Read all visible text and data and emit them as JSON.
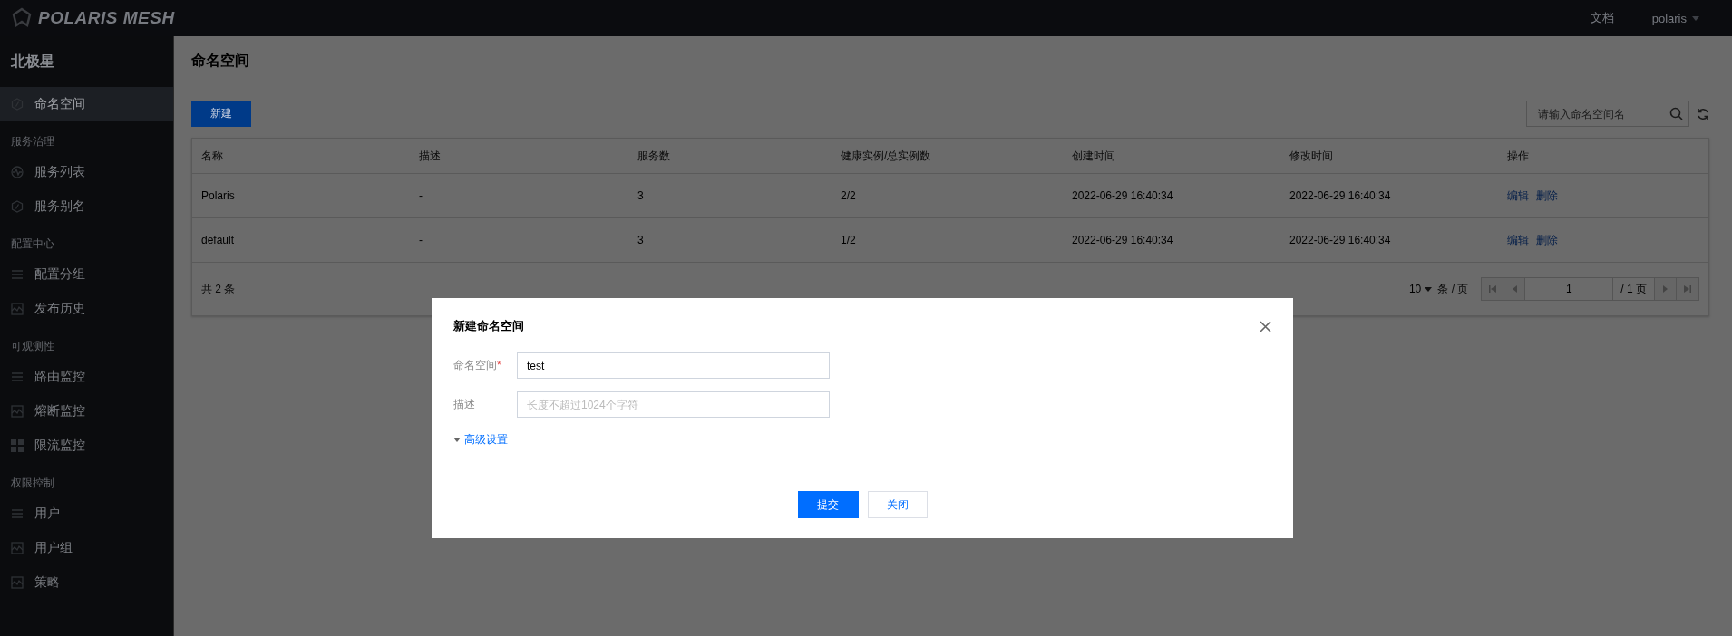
{
  "topbar": {
    "logo": "POLARIS MESH",
    "links": [
      "文档"
    ],
    "user": "polaris"
  },
  "sidebar": {
    "title": "北极星",
    "sections": [
      {
        "items": [
          {
            "label": "命名空间",
            "selected": true
          }
        ]
      },
      {
        "heading": "服务治理",
        "items": [
          {
            "label": "服务列表",
            "selected": false
          },
          {
            "label": "服务别名",
            "selected": false
          }
        ]
      },
      {
        "heading": "配置中心",
        "items": [
          {
            "label": "配置分组",
            "selected": false
          },
          {
            "label": "发布历史",
            "selected": false
          }
        ]
      },
      {
        "heading": "可观测性",
        "items": [
          {
            "label": "路由监控",
            "selected": false
          },
          {
            "label": "熔断监控",
            "selected": false
          },
          {
            "label": "限流监控",
            "selected": false
          }
        ]
      },
      {
        "heading": "权限控制",
        "items": [
          {
            "label": "用户",
            "selected": false
          },
          {
            "label": "用户组",
            "selected": false
          },
          {
            "label": "策略",
            "selected": false
          }
        ]
      }
    ]
  },
  "page": {
    "title": "命名空间",
    "create_button": "新建",
    "search": {
      "placeholder": "请输入命名空间名"
    }
  },
  "table": {
    "columns": [
      "名称",
      "描述",
      "服务数",
      "健康实例/总实例数",
      "创建时间",
      "修改时间",
      "操作"
    ],
    "rows": [
      {
        "cells": [
          "Polaris",
          "-",
          "3",
          "2/2",
          "2022-06-29 16:40:34",
          "2022-06-29 16:40:34"
        ],
        "actions": [
          "编辑",
          "删除"
        ]
      },
      {
        "cells": [
          "default",
          "-",
          "3",
          "1/2",
          "2022-06-29 16:40:34",
          "2022-06-29 16:40:34"
        ],
        "actions": [
          "编辑",
          "删除"
        ]
      }
    ],
    "total": "共 2 条",
    "page_size": "10",
    "page_size_unit": "条 / 页",
    "page": "1",
    "page_count": "/ 1 页"
  },
  "dialog": {
    "title": "新建命名空间",
    "fields": [
      {
        "label": "命名空间",
        "required_mark": "*",
        "value": "test"
      },
      {
        "label": "描述",
        "placeholder": "长度不超过1024个字符"
      }
    ],
    "advanced": "高级设置",
    "buttons": [
      {
        "label": "提交",
        "primary": true
      },
      {
        "label": "关闭",
        "primary": false
      }
    ]
  }
}
